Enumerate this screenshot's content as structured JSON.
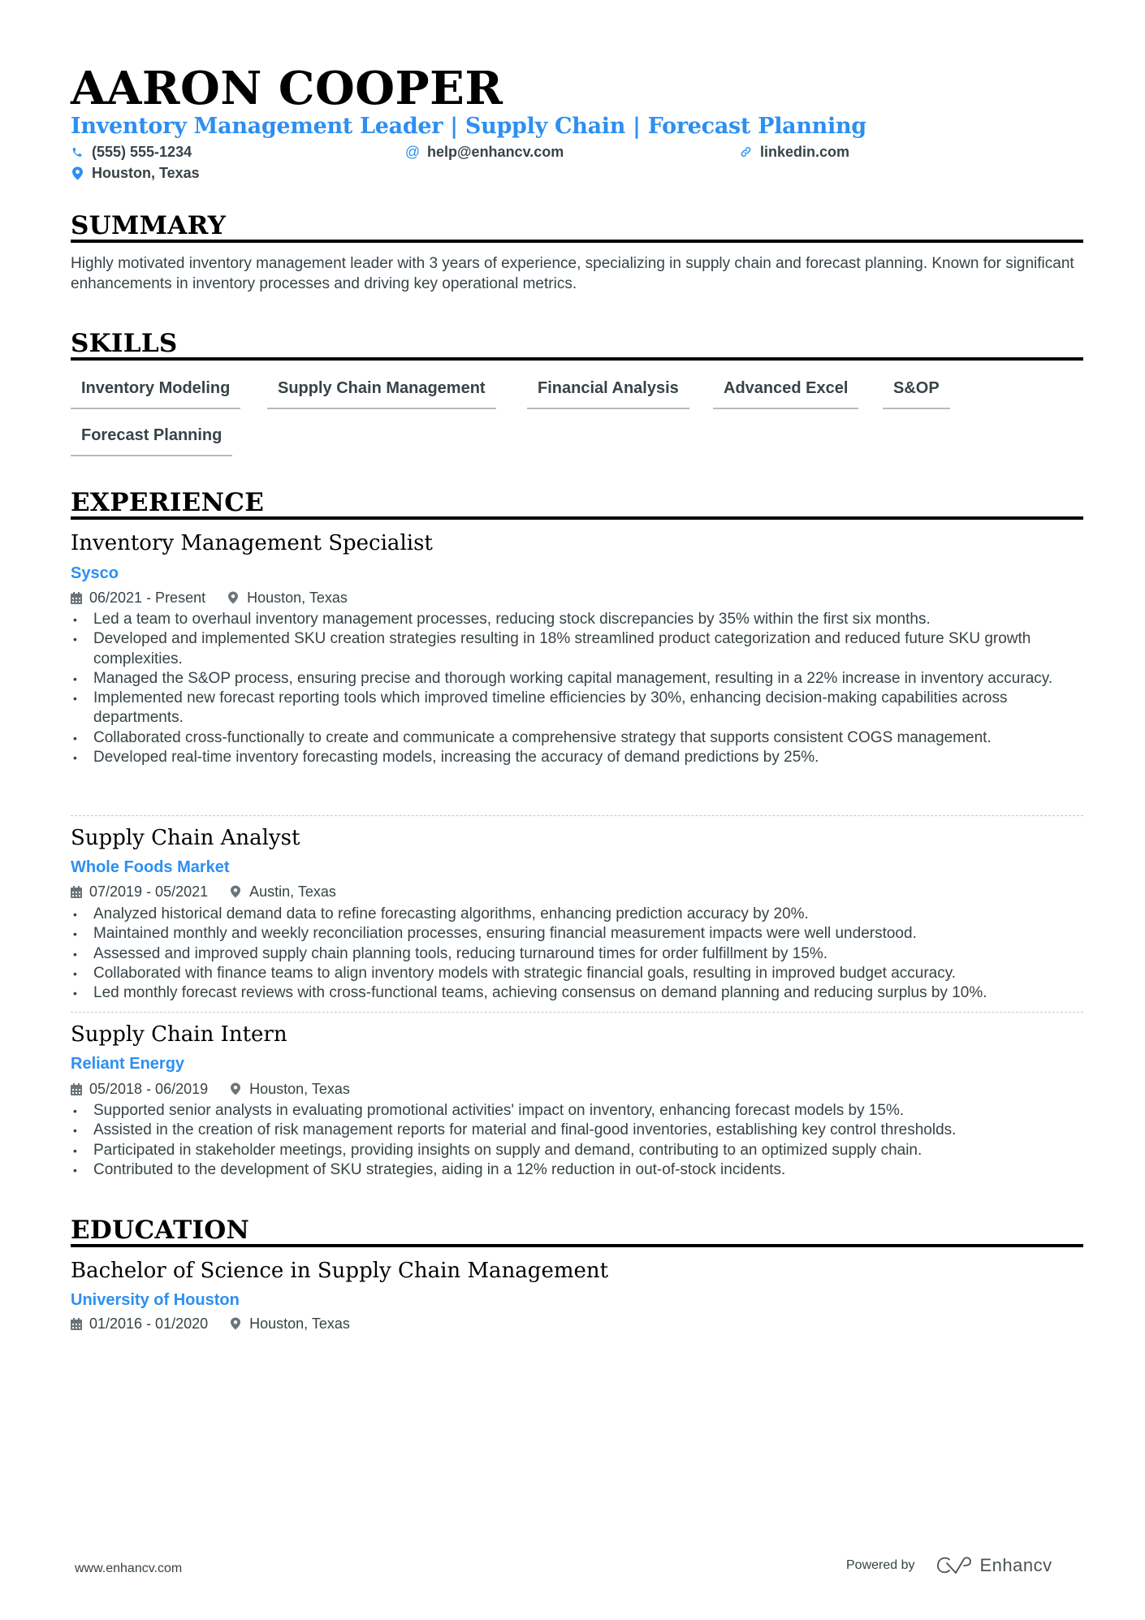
{
  "header": {
    "name": "AARON COOPER",
    "headline": "Inventory Management Leader | Supply Chain | Forecast Planning",
    "contacts": {
      "phone": {
        "icon": "phone-icon",
        "value": "(555) 555-1234"
      },
      "email": {
        "icon": "at-icon",
        "value": "help@enhancv.com"
      },
      "linkedin": {
        "icon": "link-icon",
        "value": "linkedin.com"
      },
      "location": {
        "icon": "map-pin-icon",
        "value": "Houston, Texas"
      }
    }
  },
  "colors": {
    "accent": "#2d8ff0",
    "text": "#384347",
    "heading": "#000000"
  },
  "summary": {
    "title": "SUMMARY",
    "text": "Highly motivated inventory management leader with 3 years of experience, specializing in supply chain and forecast planning. Known for significant enhancements in inventory processes and driving key operational metrics."
  },
  "skills": {
    "title": "SKILLS",
    "items": [
      "Inventory Modeling",
      "Supply Chain Management",
      "Financial Analysis",
      "Advanced Excel",
      "S&OP",
      "Forecast Planning"
    ]
  },
  "experience": {
    "title": "EXPERIENCE",
    "jobs": [
      {
        "title": "Inventory Management Specialist",
        "company": "Sysco",
        "dates": "06/2021 - Present",
        "location": "Houston, Texas",
        "bullets": [
          "Led a team to overhaul inventory management processes, reducing stock discrepancies by 35% within the first six months.",
          "Developed and implemented SKU creation strategies resulting in 18% streamlined product categorization and reduced future SKU growth complexities.",
          "Managed the S&OP process, ensuring precise and thorough working capital management, resulting in a 22% increase in inventory accuracy.",
          "Implemented new forecast reporting tools which improved timeline efficiencies by 30%, enhancing decision-making capabilities across departments.",
          "Collaborated cross-functionally to create and communicate a comprehensive strategy that supports consistent COGS management.",
          "Developed real-time inventory forecasting models, increasing the accuracy of demand predictions by 25%."
        ]
      },
      {
        "title": "Supply Chain Analyst",
        "company": "Whole Foods Market",
        "dates": "07/2019 - 05/2021",
        "location": "Austin, Texas",
        "bullets": [
          "Analyzed historical demand data to refine forecasting algorithms, enhancing prediction accuracy by 20%.",
          "Maintained monthly and weekly reconciliation processes, ensuring financial measurement impacts were well understood.",
          "Assessed and improved supply chain planning tools, reducing turnaround times for order fulfillment by 15%.",
          "Collaborated with finance teams to align inventory models with strategic financial goals, resulting in improved budget accuracy.",
          "Led monthly forecast reviews with cross-functional teams, achieving consensus on demand planning and reducing surplus by 10%."
        ]
      },
      {
        "title": "Supply Chain Intern",
        "company": "Reliant Energy",
        "dates": "05/2018 - 06/2019",
        "location": "Houston, Texas",
        "bullets": [
          "Supported senior analysts in evaluating promotional activities' impact on inventory, enhancing forecast models by 15%.",
          "Assisted in the creation of risk management reports for material and final-good inventories, establishing key control thresholds.",
          "Participated in stakeholder meetings, providing insights on supply and demand, contributing to an optimized supply chain.",
          "Contributed to the development of SKU strategies, aiding in a 12% reduction in out-of-stock incidents."
        ]
      }
    ]
  },
  "education": {
    "title": "EDUCATION",
    "items": [
      {
        "degree": "Bachelor of Science in Supply Chain Management",
        "school": "University of Houston",
        "dates": "01/2016 - 01/2020",
        "location": "Houston, Texas"
      }
    ]
  },
  "footer": {
    "website": "www.enhancv.com",
    "powered_by": "Powered by",
    "brand": "Enhancv"
  }
}
